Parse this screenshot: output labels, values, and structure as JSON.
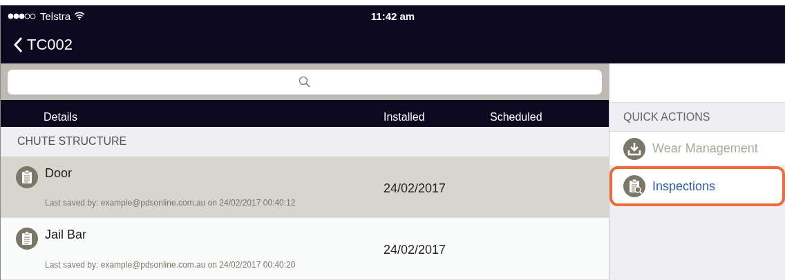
{
  "status_bar": {
    "carrier": "Telstra",
    "time": "11:42 am"
  },
  "nav": {
    "back_title": "TC002"
  },
  "table": {
    "columns": [
      "Details",
      "Installed",
      "Scheduled"
    ],
    "section": "CHUTE STRUCTURE",
    "rows": [
      {
        "name": "Door",
        "saved": "Last saved by: example@pdsonline.com.au on 24/02/2017 00:40:12",
        "installed": "24/02/2017",
        "selected": true
      },
      {
        "name": "Jail Bar",
        "saved": "Last saved by: example@pdsonline.com.au on 24/02/2017 00:40:20",
        "installed": "24/02/2017",
        "selected": false
      }
    ]
  },
  "quick_actions": {
    "title": "QUICK ACTIONS",
    "items": [
      {
        "label": "Wear Management",
        "kind": "download",
        "disabled": true,
        "highlighted": false
      },
      {
        "label": "Inspections",
        "kind": "inspect",
        "disabled": false,
        "highlighted": true
      }
    ]
  }
}
